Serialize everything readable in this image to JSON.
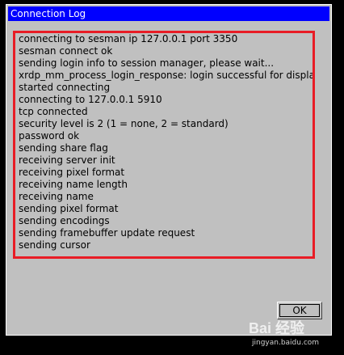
{
  "window": {
    "title": "Connection Log"
  },
  "log": {
    "lines": [
      "connecting to sesman ip 127.0.0.1 port 3350",
      "sesman connect ok",
      "sending login info to session manager, please wait...",
      "xrdp_mm_process_login_response: login successful for display",
      "started connecting",
      "connecting to 127.0.0.1 5910",
      "tcp connected",
      "security level is 2 (1 = none, 2 = standard)",
      "password ok",
      "sending share flag",
      "receiving server init",
      "receiving pixel format",
      "receiving name length",
      "receiving name",
      "sending pixel format",
      "sending encodings",
      "sending framebuffer update request",
      "sending cursor"
    ]
  },
  "buttons": {
    "ok_label": "OK"
  },
  "watermark": {
    "logo": "Bai 经验",
    "url": "jingyan.baidu.com"
  },
  "colors": {
    "titlebar": "#0000ff",
    "highlight_border": "#e81c25",
    "window_bg": "#c0c0c0"
  }
}
